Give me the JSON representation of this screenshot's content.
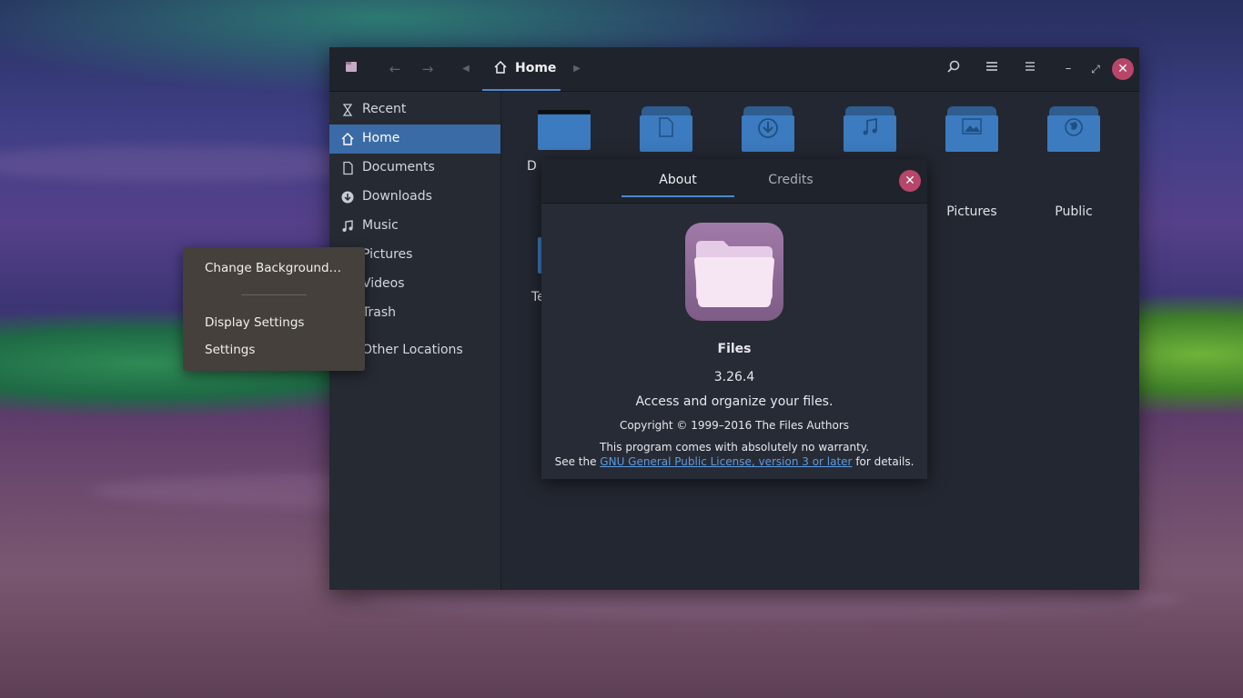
{
  "headerbar": {
    "path_label": "Home"
  },
  "sidebar": {
    "items": [
      {
        "label": "Recent"
      },
      {
        "label": "Home"
      },
      {
        "label": "Documents"
      },
      {
        "label": "Downloads"
      },
      {
        "label": "Music"
      },
      {
        "label": "Pictures"
      },
      {
        "label": "Videos"
      },
      {
        "label": "Trash"
      },
      {
        "label": "Other Locations"
      }
    ]
  },
  "content": {
    "folders_visible": [
      {
        "label": "Pictures"
      },
      {
        "label": "Public"
      }
    ],
    "partial_labels": [
      "D",
      "Te"
    ]
  },
  "context_menu": {
    "items": [
      {
        "label": "Change Background…"
      },
      {
        "label": "Display Settings"
      },
      {
        "label": "Settings"
      }
    ]
  },
  "about": {
    "tabs": [
      {
        "label": "About"
      },
      {
        "label": "Credits"
      }
    ],
    "app_name": "Files",
    "version": "3.26.4",
    "description": "Access and organize your files.",
    "copyright": "Copyright © 1999–2016 The Files Authors",
    "warranty": "This program comes with absolutely no warranty.",
    "license_prefix": "See the ",
    "license_link": "GNU General Public License, version 3 or later",
    "license_suffix": " for details."
  },
  "colors": {
    "accent": "#3a6ba6",
    "close": "#b8456a",
    "folder": "#3c7bbf"
  }
}
